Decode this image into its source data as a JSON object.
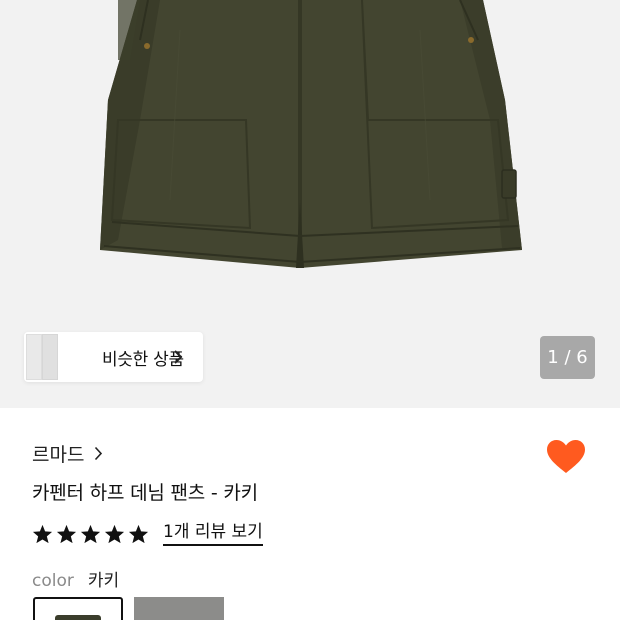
{
  "gallery": {
    "similar_button_label": "비슷한 상품",
    "page_indicator": "1 / 6",
    "image_alt": "khaki carpenter half denim shorts"
  },
  "product": {
    "brand": "르마드",
    "title": "카펜터 하프 데님 팬츠 - 카키",
    "rating_stars": 5,
    "review_link": "1개 리뷰 보기",
    "liked": true,
    "heart_color": "#ff5a1f"
  },
  "options": {
    "color_label": "color",
    "color_value": "카키",
    "swatches": [
      "카키",
      "그레이"
    ]
  },
  "colors": {
    "product_khaki": "#444632",
    "gallery_bg": "#f2f2f2",
    "indicator_bg": "#a8a8a8"
  }
}
